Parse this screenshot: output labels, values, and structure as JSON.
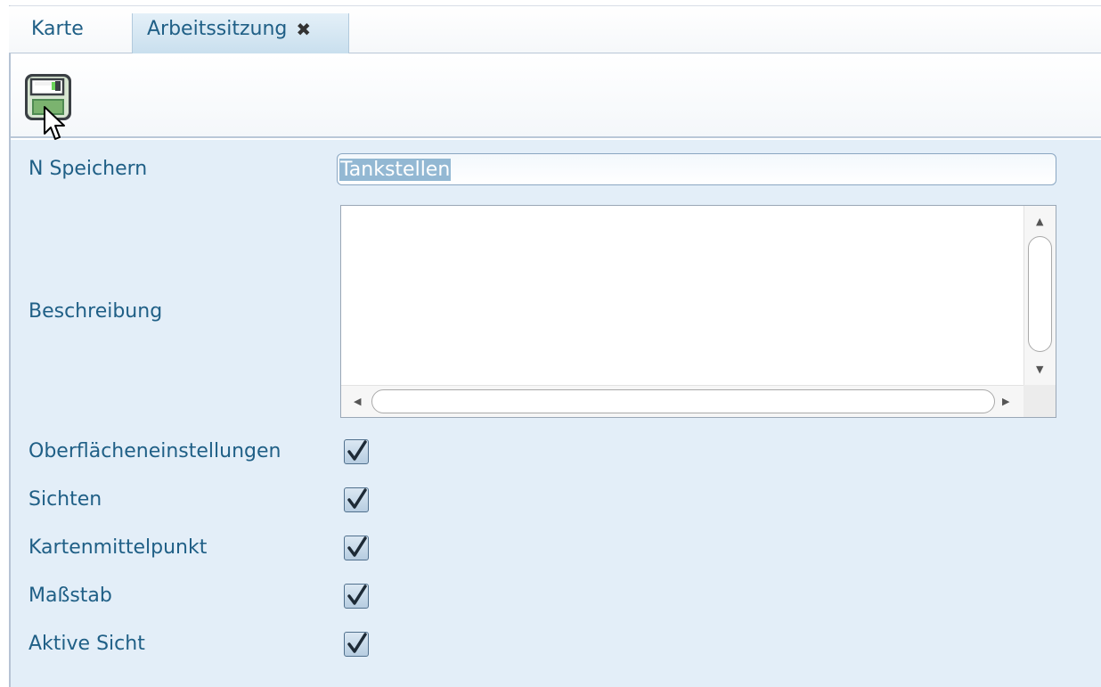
{
  "tabs": {
    "karte": "Karte",
    "arbeitssitzung": "Arbeitssitzung"
  },
  "toolbar": {
    "save_icon": "floppy-disk-icon"
  },
  "form": {
    "name_label": "N Speichern",
    "name_value": "Tankstellen",
    "description_label": "Beschreibung",
    "description_value": "",
    "checkboxes": [
      {
        "label": "Oberflächeneinstellungen",
        "checked": true
      },
      {
        "label": "Sichten",
        "checked": true
      },
      {
        "label": "Kartenmittelpunkt",
        "checked": true
      },
      {
        "label": "Maßstab",
        "checked": true
      },
      {
        "label": "Aktive Sicht",
        "checked": true
      }
    ]
  },
  "colors": {
    "label_text": "#1f5f86",
    "form_background": "#e3eef8",
    "active_tab": "#c9dfee",
    "selection": "#93b8d3"
  }
}
